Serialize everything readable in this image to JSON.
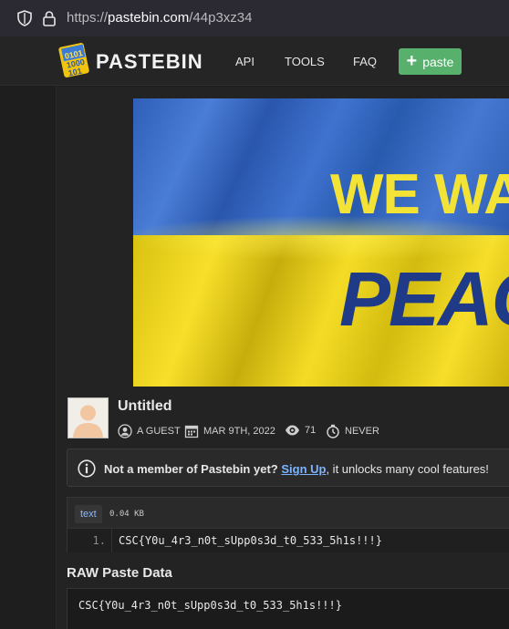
{
  "browser": {
    "url_scheme": "https://",
    "url_host": "pastebin.com",
    "url_path": "/44p3xz34"
  },
  "header": {
    "logo_text": "PASTEBIN",
    "nav": [
      "API",
      "TOOLS",
      "FAQ"
    ],
    "paste_button": "paste",
    "accent_color": "#57b16c"
  },
  "banner": {
    "line1": "WE WA",
    "line2": "PEAC",
    "colors": {
      "blue": "#2f5fb8",
      "yellow": "#f7df2a"
    }
  },
  "paste": {
    "title": "Untitled",
    "author": "A GUEST",
    "date": "MAR 9TH, 2022",
    "views": "71",
    "expiration": "NEVER"
  },
  "notice": {
    "lead": "Not a member of Pastebin yet?",
    "link": "Sign Up",
    "tail": ", it unlocks many cool features!"
  },
  "code": {
    "language": "text",
    "size": "0.04 KB",
    "line_number": "1.",
    "line_text": "CSC{Y0u_4r3_n0t_sUpp0s3d_t0_533_5h1s!!!}"
  },
  "raw": {
    "title": "RAW Paste Data",
    "text": "CSC{Y0u_4r3_n0t_sUpp0s3d_t0_533_5h1s!!!}"
  }
}
